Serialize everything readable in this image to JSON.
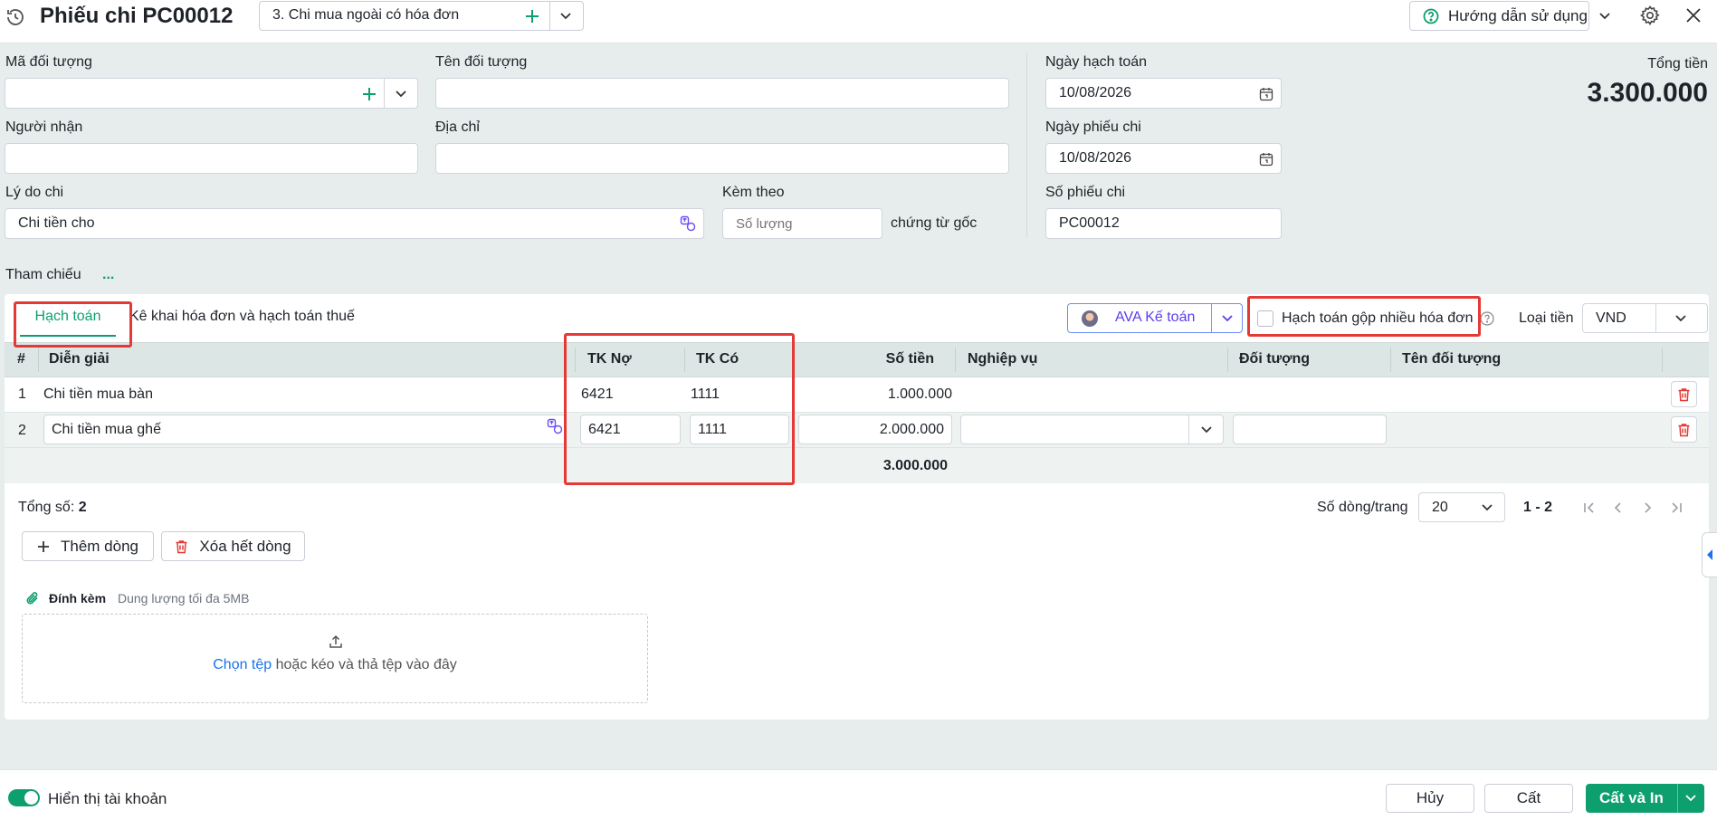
{
  "header": {
    "title": "Phiếu chi PC00012",
    "type_select": "3. Chi mua ngoài có hóa đơn",
    "help_label": "Hướng dẫn sử dụng"
  },
  "form": {
    "ma_doi_tuong_label": "Mã đối tượng",
    "ma_doi_tuong_value": "",
    "ten_doi_tuong_label": "Tên đối tượng",
    "ten_doi_tuong_value": "",
    "nguoi_nhan_label": "Người nhận",
    "nguoi_nhan_value": "",
    "dia_chi_label": "Địa chỉ",
    "dia_chi_value": "",
    "ly_do_label": "Lý do chi",
    "ly_do_value": "Chi tiền cho",
    "kem_theo_label": "Kèm theo",
    "kem_theo_placeholder": "Số lượng",
    "chung_tu_goc": "chứng từ gốc",
    "ngay_hach_toan_label": "Ngày hạch toán",
    "ngay_hach_toan_value": "10/08/2026",
    "ngay_phieu_chi_label": "Ngày phiếu chi",
    "ngay_phieu_chi_value": "10/08/2026",
    "so_phieu_chi_label": "Số phiếu chi",
    "so_phieu_chi_value": "PC00012",
    "tong_tien_label": "Tổng tiền",
    "tong_tien_value": "3.300.000",
    "tham_chieu_label": "Tham chiếu",
    "tham_chieu_more": "..."
  },
  "tabs": [
    {
      "label": "Hạch toán",
      "active": true
    },
    {
      "label": "Kê khai hóa đơn và hạch toán thuế",
      "active": false
    }
  ],
  "toolbar": {
    "ava_label": "AVA Kế toán",
    "gop_label": "Hạch toán gộp nhiều hóa đơn",
    "loai_tien_label": "Loại tiền",
    "loai_tien_value": "VND"
  },
  "table": {
    "columns": [
      "#",
      "Diễn giải",
      "TK Nợ",
      "TK Có",
      "Số tiền",
      "Nghiệp vụ",
      "Đối tượng",
      "Tên đối tượng"
    ],
    "rows": [
      {
        "no": "1",
        "dien_giai": "Chi tiền mua bàn",
        "tk_no": "6421",
        "tk_co": "1111",
        "so_tien": "1.000.000",
        "nghiep_vu": "",
        "doi_tuong": "",
        "ten_doi_tuong": ""
      },
      {
        "no": "2",
        "dien_giai": "Chi tiền mua ghế",
        "tk_no": "6421",
        "tk_co": "1111",
        "so_tien": "2.000.000",
        "nghiep_vu": "",
        "doi_tuong": "",
        "ten_doi_tuong": ""
      }
    ],
    "total_amount": "3.000.000"
  },
  "pagination": {
    "total_label": "Tổng số:",
    "total_value": "2",
    "rows_per_page_label": "Số dòng/trang",
    "rows_per_page": "20",
    "range": "1 - 2"
  },
  "actions": {
    "add_row": "Thêm dòng",
    "clear_rows": "Xóa hết dòng"
  },
  "attach": {
    "label": "Đính kèm",
    "hint": "Dung lượng tối đa 5MB",
    "choose": "Chọn tệp",
    "drop": "hoặc kéo và thả tệp vào đây"
  },
  "footer": {
    "toggle_label": "Hiển thị tài khoản",
    "cancel": "Hủy",
    "save": "Cất",
    "save_print": "Cất và In"
  },
  "colors": {
    "primary": "#0e9f6e",
    "annotation": "#e53935",
    "link": "#1a73e8",
    "ava": "#6b4cf6"
  }
}
